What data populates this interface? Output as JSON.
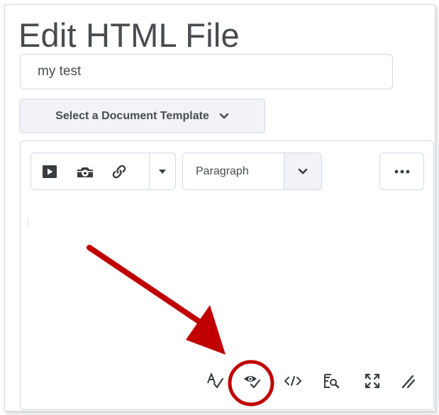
{
  "page": {
    "title": "Edit HTML File"
  },
  "title_field": {
    "value": "my test"
  },
  "template_button": {
    "label": "Select a Document Template"
  },
  "toolbar": {
    "block_format": "Paragraph",
    "icons": [
      "insert-video-icon",
      "insert-image-icon",
      "insert-link-icon",
      "more-insert-options-icon",
      "paragraph-chevron-icon",
      "more-actions-icon"
    ]
  },
  "status_bar": {
    "icons": [
      "spellcheck-icon",
      "accessibility-checker-icon",
      "source-code-icon",
      "preview-icon",
      "fullscreen-icon",
      "resize-handle-icon"
    ]
  },
  "annotation": {
    "arrow_color": "#c00000",
    "highlight": "accessibility-checker-icon"
  },
  "colors": {
    "text": "#494c4e",
    "border": "#d3d9e3",
    "button_bg": "#f1f3f6",
    "annotation_red": "#c00000"
  }
}
